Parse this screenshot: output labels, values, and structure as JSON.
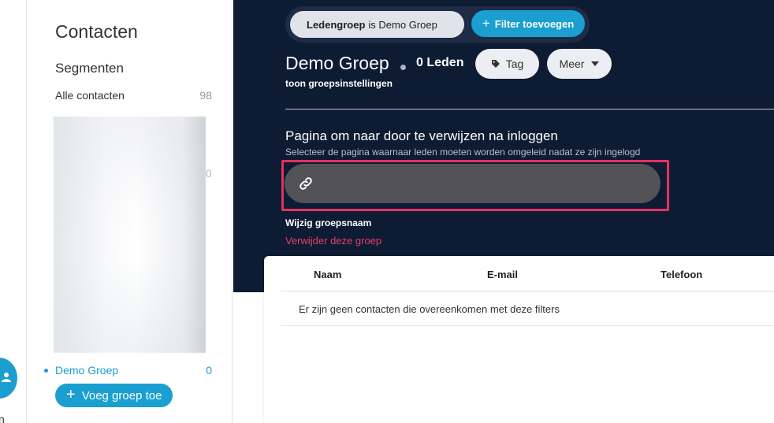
{
  "rail": {
    "partial_label": "n"
  },
  "sidebar": {
    "title": "Contacten",
    "segments_heading": "Segmenten",
    "all_contacts": {
      "label": "Alle contacten",
      "count": "98"
    },
    "blurred_count": "0",
    "demo_group": {
      "label": "Demo Groep",
      "count": "0"
    },
    "add_group_label": "Voeg groep toe"
  },
  "filter": {
    "chip_field": "Ledengroep",
    "chip_rest": "is Demo Groep",
    "add_filter_label": "Filter toevoegen"
  },
  "group": {
    "title": "Demo Groep",
    "members": "0 Leden",
    "tag_label": "Tag",
    "more_label": "Meer",
    "settings_link": "toon groepsinstellingen"
  },
  "redirect": {
    "title": "Pagina om naar door te verwijzen na inloggen",
    "subtitle": "Selecteer de pagina waarnaar leden moeten worden omgeleid nadat ze zijn ingelogd",
    "url_value": ""
  },
  "actions": {
    "rename": "Wijzig groepsnaam",
    "delete": "Verwijder deze groep"
  },
  "table": {
    "columns": [
      "Naam",
      "E-mail",
      "Telefoon"
    ],
    "empty_message": "Er zijn geen contacten die overeenkomen met deze filters"
  },
  "colors": {
    "accent": "#1a9fd0",
    "header_bg": "#0d1b33",
    "danger": "#e5406a",
    "highlight": "#e5305f"
  }
}
